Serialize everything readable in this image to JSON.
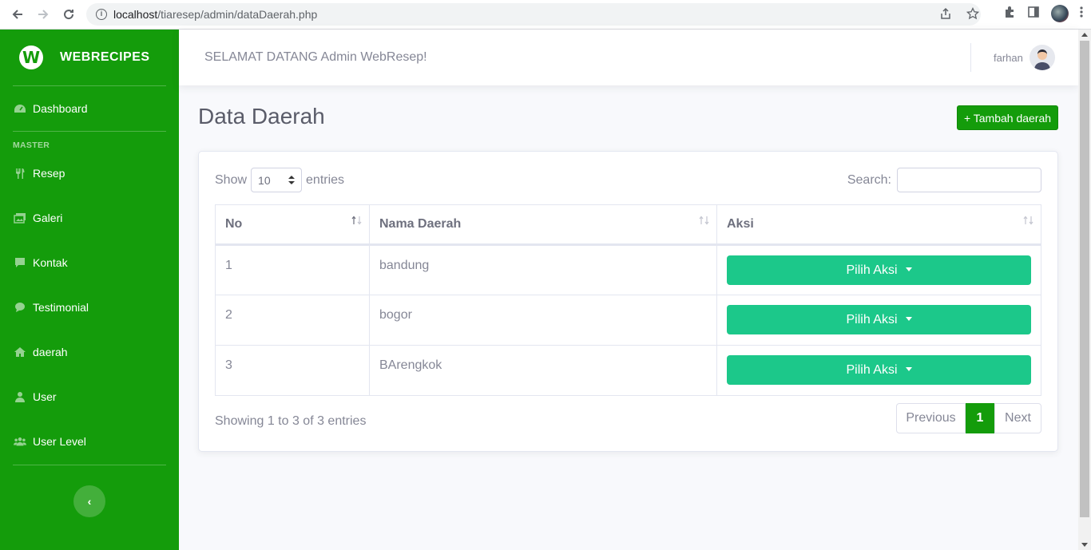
{
  "browser": {
    "url_host": "localhost",
    "url_path": "/tiaresep/admin/dataDaerah.php"
  },
  "sidebar": {
    "brand_logo": "W",
    "brand_name": "WEBRECIPES",
    "dashboard_label": "Dashboard",
    "heading": "MASTER",
    "items": [
      {
        "label": "Resep",
        "icon": "utensils-icon"
      },
      {
        "label": "Galeri",
        "icon": "images-icon"
      },
      {
        "label": "Kontak",
        "icon": "comment-square-icon"
      },
      {
        "label": "Testimonial",
        "icon": "comment-icon"
      },
      {
        "label": "daerah",
        "icon": "home-icon"
      },
      {
        "label": "User",
        "icon": "user-icon"
      },
      {
        "label": "User Level",
        "icon": "users-icon"
      }
    ],
    "toggle_icon": "‹"
  },
  "topbar": {
    "welcome": "SELAMAT DATANG Admin WebResep!",
    "username": "farhan"
  },
  "page": {
    "title": "Data Daerah",
    "add_button": "+ Tambah daerah"
  },
  "table_controls": {
    "show_label": "Show",
    "entries_label": "entries",
    "length_value": "10",
    "search_label": "Search:",
    "search_value": ""
  },
  "table": {
    "headers": [
      "No",
      "Nama Daerah",
      "Aksi"
    ],
    "rows": [
      {
        "no": "1",
        "nama": "bandung",
        "aksi": "Pilih Aksi"
      },
      {
        "no": "2",
        "nama": "bogor",
        "aksi": "Pilih Aksi"
      },
      {
        "no": "3",
        "nama": "BArengkok",
        "aksi": "Pilih Aksi"
      }
    ]
  },
  "footer": {
    "info": "Showing 1 to 3 of 3 entries",
    "prev": "Previous",
    "current": "1",
    "next": "Next"
  },
  "colors": {
    "sidebar": "#149c0b",
    "action_button": "#1cc88a",
    "primary": "#149c0b"
  }
}
